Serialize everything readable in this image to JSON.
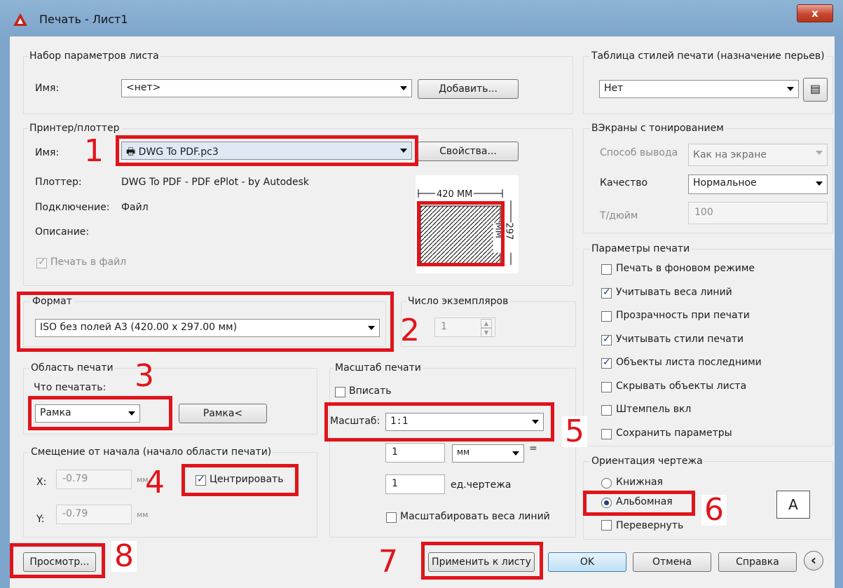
{
  "window": {
    "title": "Печать - Лист1",
    "close": "x"
  },
  "page_setup": {
    "group": "Набор параметров листа",
    "name_label": "Имя:",
    "name_value": "<нет>",
    "add_button": "Добавить..."
  },
  "printer": {
    "group": "Принтер/плоттер",
    "name_label": "Имя:",
    "name_value": "DWG To PDF.pc3",
    "properties_button": "Свойства...",
    "plotter_label": "Плоттер:",
    "plotter_value": "DWG To PDF - PDF ePlot - by Autodesk",
    "connection_label": "Подключение:",
    "connection_value": "Файл",
    "description_label": "Описание:",
    "print_to_file": "Печать в файл",
    "print_to_file_checked": true,
    "preview_width": "420 ММ",
    "preview_height": "297 ММ"
  },
  "format": {
    "group": "Формат",
    "value": "ISO без полей А3 (420.00 x 297.00 мм)"
  },
  "copies": {
    "group": "Число экземпляров",
    "value": "1"
  },
  "area": {
    "group": "Область печати",
    "what_label": "Что печатать:",
    "what_value": "Рамка",
    "window_button": "Рамка<"
  },
  "offset": {
    "group": "Смещение от начала (начало области печати)",
    "x_label": "X:",
    "x_value": "-0.79",
    "x_unit": "мм",
    "y_label": "Y:",
    "y_value": "-0.79",
    "y_unit": "мм",
    "center": "Центрировать",
    "center_checked": true
  },
  "scale": {
    "group": "Масштаб печати",
    "fit": "Вписать",
    "fit_checked": false,
    "scale_label": "Масштаб:",
    "scale_value": "1:1",
    "units1": "1",
    "unit_value": "мм",
    "equals": "=",
    "units2": "1",
    "drawing_units": "ед.чертежа",
    "scale_lineweights": "Масштабировать веса линий",
    "scale_lineweights_checked": false
  },
  "styles": {
    "group": "Таблица стилей печати (назначение перьев)",
    "value": "Нет"
  },
  "shaded": {
    "group": "ВЭкраны с тонированием",
    "mode_label": "Способ вывода",
    "mode_value": "Как на экране",
    "quality_label": "Качество",
    "quality_value": "Нормальное",
    "dpi_label": "Т/дюйм",
    "dpi_value": "100"
  },
  "options": {
    "group": "Параметры печати",
    "items": [
      {
        "label": "Печать в фоновом режиме",
        "checked": false
      },
      {
        "label": "Учитывать веса линий",
        "checked": true
      },
      {
        "label": "Прозрачность при печати",
        "checked": false
      },
      {
        "label": "Учитывать стили печати",
        "checked": true
      },
      {
        "label": "Объекты листа последними",
        "checked": true
      },
      {
        "label": "Скрывать объекты листа",
        "checked": false
      },
      {
        "label": "Штемпель вкл",
        "checked": false
      },
      {
        "label": "Сохранить параметры",
        "checked": false
      }
    ]
  },
  "orientation": {
    "group": "Ориентация чертежа",
    "portrait": "Книжная",
    "landscape": "Альбомная",
    "selected": "landscape",
    "upside_down": "Перевернуть",
    "upside_down_checked": false,
    "preview_letter": "A"
  },
  "buttons": {
    "preview": "Просмотр...",
    "apply": "Применить к листу",
    "ok": "OK",
    "cancel": "Отмена",
    "help": "Справка",
    "more": "‹"
  },
  "annotations": [
    "1",
    "2",
    "3",
    "4",
    "5",
    "6",
    "7",
    "8"
  ],
  "colors": {
    "annotation": "#e0141b",
    "titlebar": "#8fb4d6"
  }
}
